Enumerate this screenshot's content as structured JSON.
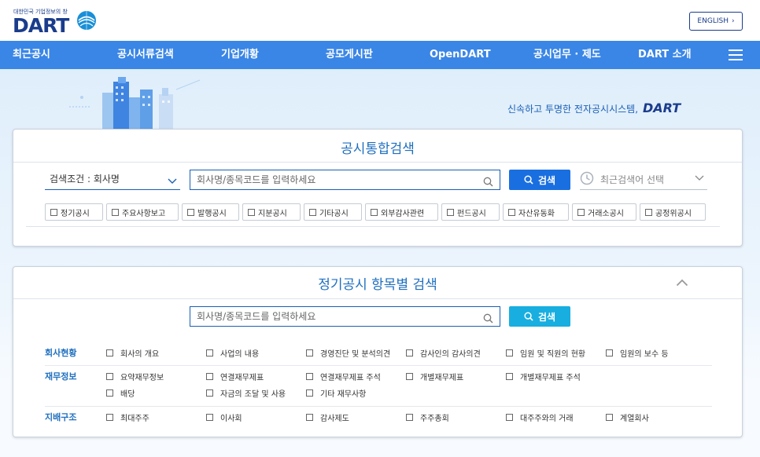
{
  "header": {
    "logo_tagline": "대한민국 기업정보의 창",
    "logo_word": "DART",
    "english_button": "ENGLISH",
    "english_chevron": "›"
  },
  "nav": {
    "items": [
      "최근공시",
      "공시서류검색",
      "기업개황",
      "공모게시판",
      "OpenDART",
      "공시업무 · 제도",
      "DART 소개"
    ],
    "menu_icon": "hamburger-icon"
  },
  "hero": {
    "slogan": "신속하고 투명한 전자공시시스템,",
    "slogan_brand": "DART"
  },
  "integrated_search": {
    "title": "공시통합검색",
    "condition_label": "검색조건 : 회사명",
    "input_placeholder": "회사명/종목코드를 입력하세요",
    "search_button": "검색",
    "recent_label": "최근검색어 선택",
    "categories": [
      "정기공시",
      "주요사항보고",
      "발행공시",
      "지분공시",
      "기타공시",
      "외부감사관련",
      "펀드공시",
      "자산유동화",
      "거래소공시",
      "공정위공시"
    ]
  },
  "item_search": {
    "title": "정기공시 항목별 검색",
    "input_placeholder": "회사명/종목코드를 입력하세요",
    "search_button": "검색",
    "groups": [
      {
        "label": "회사현황",
        "options": [
          "회사의 개요",
          "사업의 내용",
          "경영진단 및 분석의견",
          "감사인의 감사의견",
          "임원 및 직원의 현황",
          "임원의 보수 등"
        ]
      },
      {
        "label": "재무정보",
        "options": [
          "요약재무정보",
          "연결재무제표",
          "연결재무제표 주석",
          "개별재무제표",
          "개별재무제표 주석",
          "배당",
          "자금의 조달 및 사용",
          "기타 재무사항"
        ]
      },
      {
        "label": "지배구조",
        "options": [
          "최대주주",
          "이사회",
          "감사제도",
          "주주총회",
          "대주주와의 거래",
          "계열회사"
        ]
      }
    ]
  },
  "colors": {
    "nav_bg": "#3a86e6",
    "accent": "#1f6fbf",
    "button_blue": "#1a6fe0",
    "button_cyan": "#18aee0"
  }
}
